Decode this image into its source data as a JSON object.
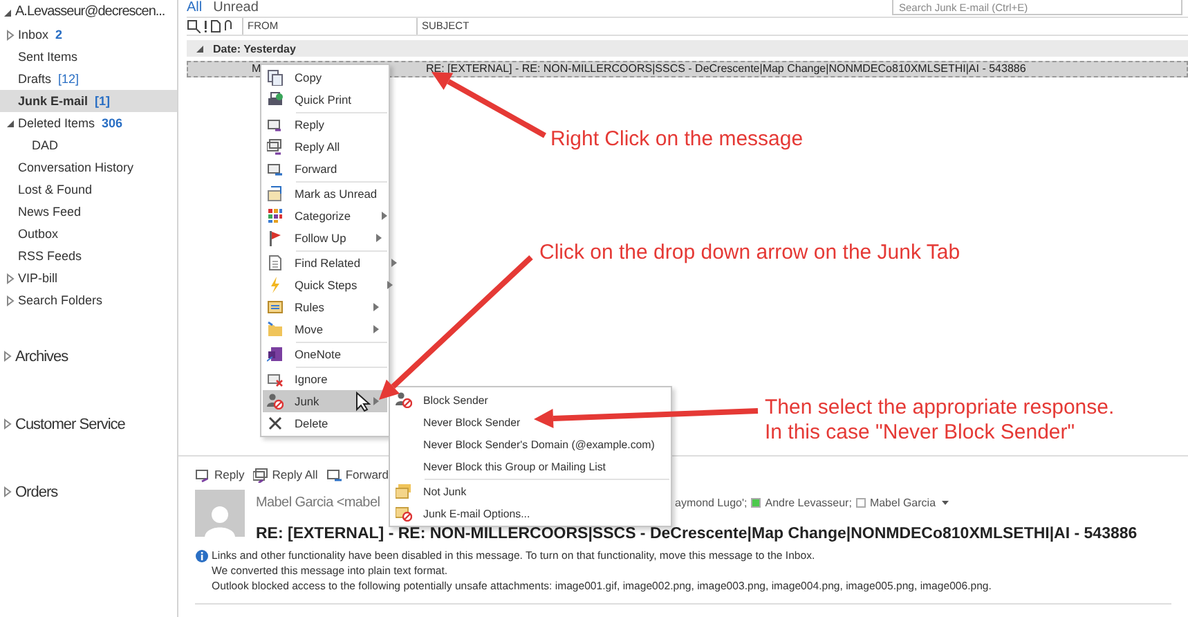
{
  "folder_pane": {
    "folders": [
      {
        "label": "A.Levasseur@decrescen...",
        "expanded": true,
        "children": [
          {
            "label": "Inbox",
            "count": "2",
            "count_bold": true,
            "expanded": false,
            "selected": false
          },
          {
            "label": "Sent Items",
            "selected": false
          },
          {
            "label": "Drafts",
            "count": "[12]",
            "count_bold": false,
            "selected": false
          },
          {
            "label": "Junk E-mail",
            "count": "[1]",
            "count_bold": false,
            "selected": true
          },
          {
            "label": "Deleted Items",
            "count": "306",
            "count_bold": true,
            "expanded": true,
            "selected": false,
            "children": [
              {
                "label": "DAD",
                "selected": false
              }
            ]
          },
          {
            "label": "Conversation History",
            "selected": false
          },
          {
            "label": "Lost & Found",
            "selected": false
          },
          {
            "label": "News Feed",
            "selected": false
          },
          {
            "label": "Outbox",
            "selected": false
          },
          {
            "label": "RSS Feeds",
            "selected": false
          },
          {
            "label": "VIP-bill",
            "expanded": false,
            "selected": false
          },
          {
            "label": "Search Folders",
            "expanded": false,
            "selected": false
          }
        ]
      },
      {
        "label": "Archives",
        "expanded": false
      },
      {
        "label": "Customer Service",
        "expanded": false
      },
      {
        "label": "Orders",
        "expanded": false
      }
    ]
  },
  "message_list": {
    "filters": [
      {
        "label": "All",
        "selected": true
      },
      {
        "label": "Unread",
        "selected": false
      }
    ],
    "search": {
      "placeholder": "Search Junk E-mail (Ctrl+E)"
    },
    "columns": [
      "FROM",
      "SUBJECT"
    ],
    "group": {
      "label": "Date: Yesterday",
      "expanded": true
    },
    "rows": [
      {
        "from": "M",
        "subject": "RE: [EXTERNAL] - RE: NON-MILLERCOORS|SSCS - DeCrescente|Map Change|NONMDECo810XMLSETHI|AI - 543886",
        "selected": true
      }
    ]
  },
  "context_menu": {
    "groups": [
      [
        {
          "label": "Copy",
          "submenu": false,
          "selected": false
        },
        {
          "label": "Quick Print",
          "submenu": false,
          "selected": false
        }
      ],
      [
        {
          "label": "Reply",
          "submenu": false,
          "selected": false
        },
        {
          "label": "Reply All",
          "submenu": false,
          "selected": false
        },
        {
          "label": "Forward",
          "submenu": false,
          "selected": false
        }
      ],
      [
        {
          "label": "Mark as Unread",
          "submenu": false,
          "selected": false
        },
        {
          "label": "Categorize",
          "submenu": true,
          "selected": false
        },
        {
          "label": "Follow Up",
          "submenu": true,
          "selected": false
        }
      ],
      [
        {
          "label": "Find Related",
          "submenu": true,
          "selected": false
        },
        {
          "label": "Quick Steps",
          "submenu": true,
          "selected": false
        },
        {
          "label": "Rules",
          "submenu": true,
          "selected": false
        },
        {
          "label": "Move",
          "submenu": true,
          "selected": false
        }
      ],
      [
        {
          "label": "OneNote",
          "submenu": false,
          "selected": false
        }
      ],
      [
        {
          "label": "Ignore",
          "submenu": false,
          "selected": false
        },
        {
          "label": "Junk",
          "submenu": true,
          "selected": true
        },
        {
          "label": "Delete",
          "submenu": false,
          "selected": false
        }
      ]
    ]
  },
  "junk_submenu": {
    "groups": [
      [
        {
          "label": "Block Sender",
          "submenu": false,
          "selected": false
        },
        {
          "label": "Never Block Sender",
          "submenu": false,
          "selected": false
        },
        {
          "label": "Never Block Sender's Domain (@example.com)",
          "submenu": false,
          "selected": false
        },
        {
          "label": "Never Block this Group or Mailing List",
          "submenu": false,
          "selected": false
        }
      ],
      [
        {
          "label": "Not Junk",
          "submenu": false,
          "selected": false
        },
        {
          "label": "Junk E-mail Options...",
          "submenu": false,
          "selected": false
        }
      ]
    ]
  },
  "reading_pane": {
    "actions": [
      "Reply",
      "Reply All",
      "Forward"
    ],
    "sender": "Mabel Garcia <mabel",
    "recipients": [
      {
        "name": "aymond Lugo';"
      },
      {
        "name": "Andre Levasseur;",
        "color": "#4cc94c"
      },
      {
        "name": "Mabel Garcia",
        "color": "#ffffff"
      }
    ],
    "subject": "RE: [EXTERNAL] - RE: NON-MILLERCOORS|SSCS - DeCrescente|Map Change|NONMDECo810XMLSETHI|AI - 543886",
    "info": [
      "Links and other functionality have been disabled in this message. To turn on that functionality, move this message to the Inbox.",
      "We converted this message into plain text format.",
      "Outlook blocked access to the following potentially unsafe attachments: image001.gif, image002.png, image003.png, image004.png, image005.png, image006.png."
    ]
  },
  "annotations": [
    {
      "lines": [
        "Right Click on the message"
      ]
    },
    {
      "lines": [
        "Click on the drop down arrow on the Junk Tab"
      ]
    },
    {
      "lines": [
        "Then select the appropriate response.",
        "In this case \"Never Block Sender\""
      ]
    }
  ]
}
